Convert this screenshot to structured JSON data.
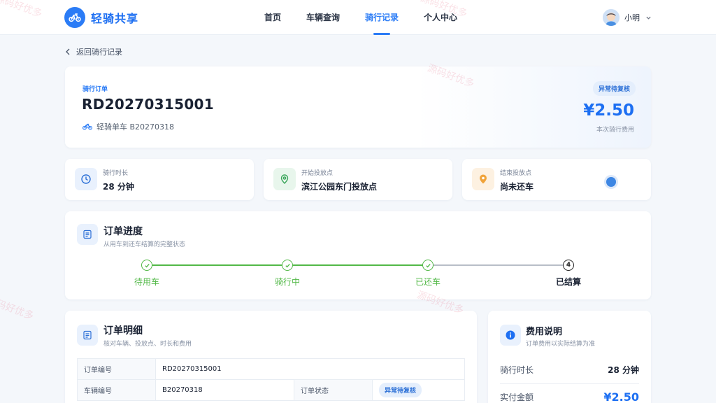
{
  "app": {
    "name": "轻骑共享"
  },
  "nav": {
    "items": [
      "首页",
      "车辆查询",
      "骑行记录",
      "个人中心"
    ],
    "active_index": 2
  },
  "user": {
    "name": "小明"
  },
  "back": {
    "label": "返回骑行记录"
  },
  "order": {
    "label": "骑行订单",
    "id": "RD20270315001",
    "bike": "轻骑单车 B20270318",
    "status_badge": "异常待复核",
    "amount": "¥2.50",
    "amount_label": "本次骑行费用"
  },
  "info_cards": [
    {
      "label": "骑行时长",
      "value": "28 分钟",
      "icon": "clock-icon"
    },
    {
      "label": "开始投放点",
      "value": "滨江公园东门投放点",
      "icon": "location-pin-icon"
    },
    {
      "label": "结束投放点",
      "value": "尚未还车",
      "icon": "location-pin-icon"
    }
  ],
  "progress": {
    "title": "订单进度",
    "subtitle": "从用车到还车结算的完整状态",
    "steps": [
      {
        "label": "待用车",
        "state": "done"
      },
      {
        "label": "骑行中",
        "state": "done"
      },
      {
        "label": "已还车",
        "state": "done"
      },
      {
        "label": "已结算",
        "state": "final",
        "number": "4"
      }
    ]
  },
  "detail": {
    "title": "订单明细",
    "subtitle": "核对车辆、投放点、时长和费用",
    "rows": {
      "order_no_label": "订单编号",
      "order_no_value": "RD20270315001",
      "vehicle_no_label": "车辆编号",
      "vehicle_no_value": "B20270318",
      "status_label": "订单状态",
      "status_value": "异常待复核"
    }
  },
  "fee": {
    "title": "费用说明",
    "subtitle": "订单费用以实际结算为准",
    "duration_label": "骑行时长",
    "duration_value": "28 分钟",
    "paid_label": "实付金额",
    "paid_value": "¥2.50"
  },
  "watermark": {
    "text": "源码好优多"
  },
  "colors": {
    "primary": "#2b7cf6",
    "success": "#52b847",
    "warning": "#f0a33a"
  }
}
